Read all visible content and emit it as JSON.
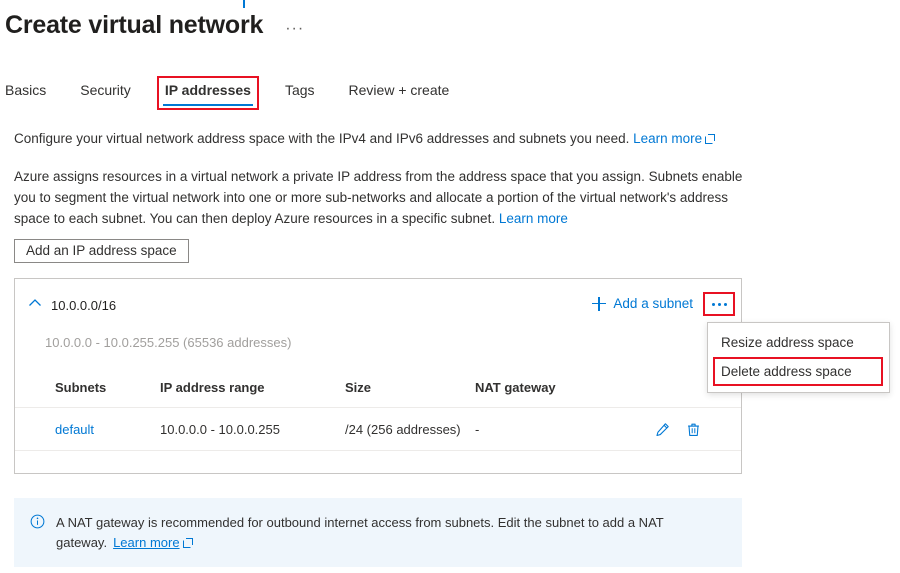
{
  "page": {
    "title": "Create virtual network",
    "title_more_label": "···"
  },
  "tabs": [
    {
      "label": "Basics",
      "selected": false
    },
    {
      "label": "Security",
      "selected": false
    },
    {
      "label": "IP addresses",
      "selected": true
    },
    {
      "label": "Tags",
      "selected": false
    },
    {
      "label": "Review + create",
      "selected": false
    }
  ],
  "intro": {
    "line1_text": "Configure your virtual network address space with the IPv4 and IPv6 addresses and subnets you need.",
    "line1_link": "Learn more",
    "paragraph_text": "Azure assigns resources in a virtual network a private IP address from the address space that you assign. Subnets enable you to segment the virtual network into one or more sub-networks and allocate a portion of the virtual network's address space to each subnet. You can then deploy Azure resources in a specific subnet.",
    "paragraph_link": "Learn more"
  },
  "toolbar": {
    "add_ip_address_space": "Add an IP address space"
  },
  "address_space": {
    "cidr": "10.0.0.0/16",
    "range_summary": "10.0.0.0 - 10.0.255.255 (65536 addresses)",
    "add_subnet_label": "Add a subnet",
    "more_label": "···",
    "columns": [
      "Subnets",
      "IP address range",
      "Size",
      "NAT gateway"
    ],
    "rows": [
      {
        "subnet": "default",
        "ip_range": "10.0.0.0 - 10.0.0.255",
        "size": "/24 (256 addresses)",
        "nat_gateway": "-"
      }
    ]
  },
  "context_menu": {
    "items": [
      {
        "label": "Resize address space",
        "highlighted": false
      },
      {
        "label": "Delete address space",
        "highlighted": true
      }
    ]
  },
  "info_banner": {
    "message": "A NAT gateway is recommended for outbound internet access from subnets. Edit the subnet to add a NAT gateway.",
    "link": "Learn more"
  },
  "colors": {
    "accent": "#0078d4",
    "annotation": "#e81123",
    "info_background": "#eff6fc",
    "muted_text": "#a19f9d",
    "border": "#c8c6c4"
  }
}
